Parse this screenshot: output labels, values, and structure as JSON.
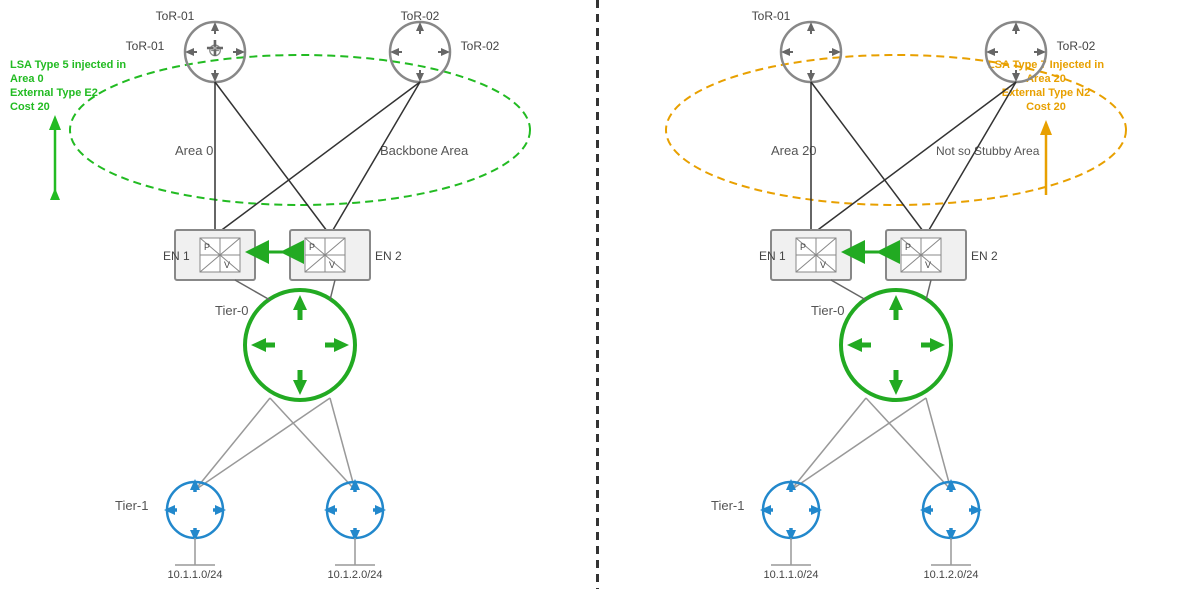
{
  "left_panel": {
    "annotation": {
      "line1": "LSA Type 5 injected in",
      "line2": "Area 0",
      "line3": "External Type E2",
      "line4": "Cost 20",
      "color": "#22bb22"
    },
    "area0_label": "Area 0",
    "backbone_label": "Backbone Area",
    "tor01_label": "ToR-01",
    "tor02_label": "ToR-02",
    "en1_label": "EN 1",
    "en2_label": "EN 2",
    "tier0_label": "Tier-0",
    "tier1_label": "Tier-1",
    "subnet1": "10.1.1.0/24",
    "subnet2": "10.1.2.0/24"
  },
  "right_panel": {
    "annotation": {
      "line1": "LSA Type 7 Injected in",
      "line2": "Area 20",
      "line3": "External Type N2",
      "line4": "Cost 20",
      "color": "#e8a000"
    },
    "area20_label": "Area 20",
    "nssa_label": "Not so Stubby Area",
    "tor01_label": "ToR-01",
    "tor02_label": "ToR-02",
    "en1_label": "EN 1",
    "en2_label": "EN 2",
    "tier0_label": "Tier-0",
    "tier1_label": "Tier-1",
    "subnet1": "10.1.1.0/24",
    "subnet2": "10.1.2.0/24"
  }
}
